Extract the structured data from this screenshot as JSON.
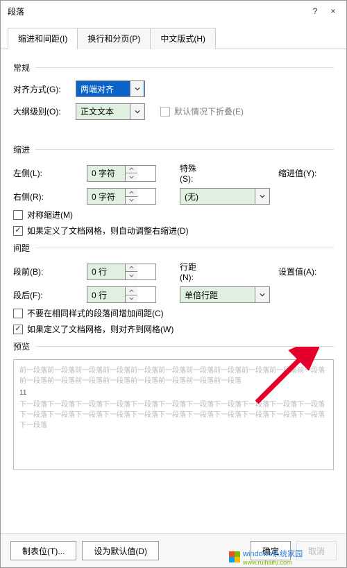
{
  "window": {
    "title": "段落",
    "help": "?",
    "close": "×"
  },
  "tabs": [
    "缩进和间距(I)",
    "换行和分页(P)",
    "中文版式(H)"
  ],
  "grp": {
    "general": "常规",
    "indent": "缩进",
    "spacing": "间距",
    "preview": "预览"
  },
  "general": {
    "align_lbl": "对齐方式(G):",
    "align_val": "两端对齐",
    "outline_lbl": "大纲级别(O):",
    "outline_val": "正文文本",
    "collapse_lbl": "默认情况下折叠(E)"
  },
  "indent": {
    "left_lbl": "左侧(L):",
    "left_val": "0 字符",
    "right_lbl": "右侧(R):",
    "right_val": "0 字符",
    "special_lbl": "特殊(S):",
    "special_val": "(无)",
    "by_lbl": "缩进值(Y):",
    "by_val": "",
    "mirror_lbl": "对称缩进(M)",
    "grid_lbl": "如果定义了文档网格，则自动调整右缩进(D)"
  },
  "spacing": {
    "before_lbl": "段前(B):",
    "before_val": "0 行",
    "after_lbl": "段后(F):",
    "after_val": "0 行",
    "line_lbl": "行距(N):",
    "line_val": "单倍行距",
    "at_lbl": "设置值(A):",
    "at_val": "",
    "nosame_lbl": "不要在相同样式的段落间增加间距(C)",
    "snap_lbl": "如果定义了文档网格，则对齐到网格(W)"
  },
  "preview": {
    "prev_line": "前一段落前一段落前一段落前一段落前一段落前一段落前一段落前一段落前一段落前一段落前一段落前一段落前一段落前一段落前一段落前一段落前一段落前一段落前一段落",
    "sample": "11",
    "next_line": "下一段落下一段落下一段落下一段落下一段落下一段落下一段落下一段落下一段落下一段落下一段落下一段落下一段落下一段落下一段落下一段落下一段落下一段落下一段落下一段落下一段落下一段落下一段落"
  },
  "buttons": {
    "tabs": "制表位(T)...",
    "default": "设为默认值(D)",
    "ok": "确定",
    "cancel": "取消"
  },
  "watermark": {
    "line1": "windows系统家园",
    "line2": "www.ruihaifu.com"
  }
}
